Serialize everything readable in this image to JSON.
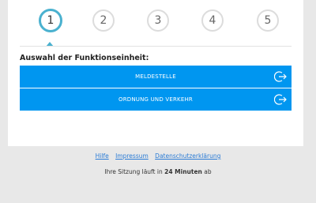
{
  "steps": [
    "1",
    "2",
    "3",
    "4",
    "5"
  ],
  "active_step": "1",
  "section_title": "Auswahl der Funktionseinheit:",
  "units": [
    {
      "label": "MELDESTELLE",
      "icon": "logout-arrow-icon"
    },
    {
      "label": "ORDNUNG UND VERKEHR",
      "icon": "logout-arrow-icon"
    }
  ],
  "footer": {
    "links": [
      "Hilfe",
      "Impressum",
      "Datenschutzerklärung"
    ],
    "session_prefix": "Ihre Sitzung läuft in ",
    "session_time": "24 Minuten",
    "session_suffix": " ab"
  },
  "colors": {
    "accent": "#4ab1cf",
    "button": "#0096f0",
    "link": "#2a7bd5",
    "background": "#e8e8e8"
  }
}
